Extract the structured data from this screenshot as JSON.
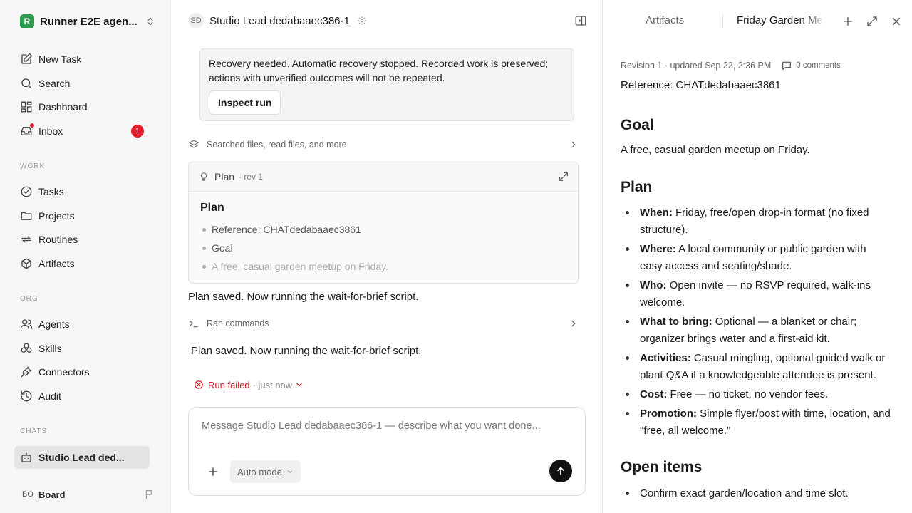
{
  "sidebar": {
    "workspace": {
      "logo": "R",
      "name": "Runner E2E agen..."
    },
    "nav": [
      {
        "label": "New Task",
        "icon": "edit-icon"
      },
      {
        "label": "Search",
        "icon": "search-icon"
      },
      {
        "label": "Dashboard",
        "icon": "dashboard-icon"
      },
      {
        "label": "Inbox",
        "icon": "inbox-icon",
        "badge": "1"
      }
    ],
    "work_label": "WORK",
    "work": [
      {
        "label": "Tasks",
        "icon": "check-circle-icon"
      },
      {
        "label": "Projects",
        "icon": "folder-icon"
      },
      {
        "label": "Routines",
        "icon": "repeat-icon"
      },
      {
        "label": "Artifacts",
        "icon": "cube-icon"
      }
    ],
    "org_label": "ORG",
    "org": [
      {
        "label": "Agents",
        "icon": "users-icon"
      },
      {
        "label": "Skills",
        "icon": "skills-icon"
      },
      {
        "label": "Connectors",
        "icon": "plug-icon"
      },
      {
        "label": "Audit",
        "icon": "history-icon"
      }
    ],
    "chats_label": "CHATS",
    "chats": [
      {
        "label": "Studio Lead ded...",
        "icon": "bot-icon"
      }
    ],
    "footer": {
      "avatar": "BO",
      "label": "Board"
    }
  },
  "chat": {
    "header": {
      "avatar": "SD",
      "title": "Studio Lead dedabaaec386-1"
    },
    "recovery": {
      "text": "Recovery needed. Automatic recovery stopped. Recorded work is preserved; actions with unverified outcomes will not be repeated.",
      "button": "Inspect run"
    },
    "activity1": "Searched files, read files, and more",
    "plan_card": {
      "title": "Plan",
      "rev": "· rev 1",
      "heading": "Plan",
      "items": [
        "Reference: CHATdedabaaec3861",
        "Goal",
        "A free, casual garden meetup on Friday."
      ]
    },
    "msg1": "Plan saved. Now running the wait-for-brief script.",
    "activity2": "Ran commands",
    "msg2": "Plan saved. Now running the wait-for-brief script.",
    "run_status": {
      "label": "Run failed",
      "time": "· just now"
    },
    "composer": {
      "placeholder": "Message Studio Lead dedabaaec386-1 — describe what you want done...",
      "mode": "Auto mode"
    }
  },
  "artifact": {
    "tabs": {
      "inactive": "Artifacts",
      "active": "Friday Garden Meetup"
    },
    "meta": {
      "revision": "Revision 1 · updated Sep 22, 2:36 PM",
      "comments": "0 comments"
    },
    "reference": "Reference: CHATdedabaaec3861",
    "goal_heading": "Goal",
    "goal_text": "A free, casual garden meetup on Friday.",
    "plan_heading": "Plan",
    "plan_items": [
      {
        "key": "When:",
        "text": " Friday, free/open drop-in format (no fixed structure)."
      },
      {
        "key": "Where:",
        "text": " A local community or public garden with easy access and seating/shade."
      },
      {
        "key": "Who:",
        "text": " Open invite — no RSVP required, walk-ins welcome."
      },
      {
        "key": "What to bring:",
        "text": " Optional — a blanket or chair; organizer brings water and a first-aid kit."
      },
      {
        "key": "Activities:",
        "text": " Casual mingling, optional guided walk or plant Q&A if a knowledgeable attendee is present."
      },
      {
        "key": "Cost:",
        "text": " Free — no ticket, no vendor fees."
      },
      {
        "key": "Promotion:",
        "text": " Simple flyer/post with time, location, and \"free, all welcome.\""
      }
    ],
    "open_heading": "Open items",
    "open_items": [
      "Confirm exact garden/location and time slot."
    ]
  },
  "colors": {
    "accent_red": "#e11d2e",
    "brand_green": "#2e9b4e",
    "send_bg": "#111111"
  }
}
